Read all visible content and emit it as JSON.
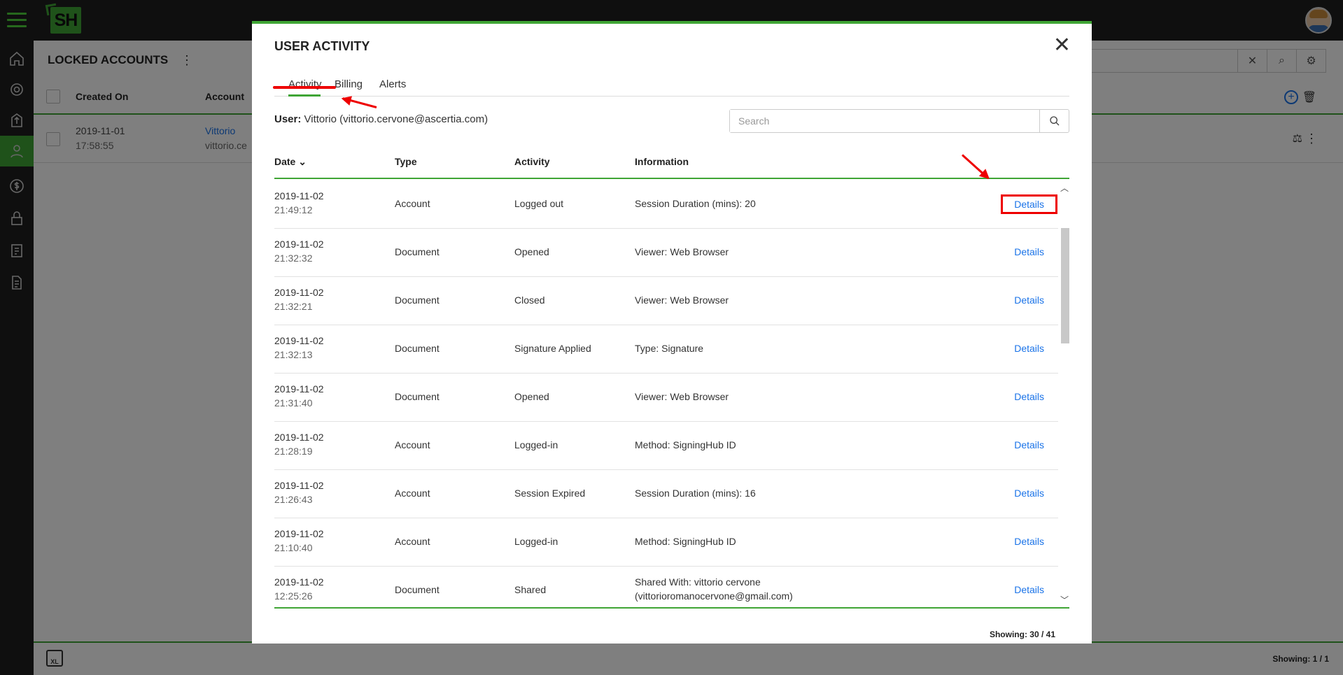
{
  "page": {
    "title": "LOCKED ACCOUNTS",
    "columns": [
      "Created On",
      "Account"
    ],
    "row": {
      "date": "2019-11-01",
      "time": "17:58:55",
      "name": "Vittorio",
      "email": "vittorio.ce"
    },
    "footer_showing": "Showing: 1 / 1",
    "footer_export": "XL"
  },
  "modal": {
    "title": "USER ACTIVITY",
    "tabs": [
      "Activity",
      "Billing",
      "Alerts"
    ],
    "active_tab": "Activity",
    "user_label": "User:",
    "user_value": "Vittorio (vittorio.cervone@ascertia.com)",
    "search_placeholder": "Search",
    "columns": {
      "date": "Date",
      "type": "Type",
      "activity": "Activity",
      "information": "Information"
    },
    "details_label": "Details",
    "rows": [
      {
        "date": "2019-11-02",
        "time": "21:49:12",
        "type": "Account",
        "activity": "Logged out",
        "info1": "Session Duration (mins): 20",
        "info2": ""
      },
      {
        "date": "2019-11-02",
        "time": "21:32:32",
        "type": "Document",
        "activity": "Opened",
        "info1": "Viewer: Web Browser",
        "info2": ""
      },
      {
        "date": "2019-11-02",
        "time": "21:32:21",
        "type": "Document",
        "activity": "Closed",
        "info1": "Viewer: Web Browser",
        "info2": ""
      },
      {
        "date": "2019-11-02",
        "time": "21:32:13",
        "type": "Document",
        "activity": "Signature Applied",
        "info1": "Type: Signature",
        "info2": ""
      },
      {
        "date": "2019-11-02",
        "time": "21:31:40",
        "type": "Document",
        "activity": "Opened",
        "info1": "Viewer: Web Browser",
        "info2": ""
      },
      {
        "date": "2019-11-02",
        "time": "21:28:19",
        "type": "Account",
        "activity": "Logged-in",
        "info1": "Method: SigningHub ID",
        "info2": ""
      },
      {
        "date": "2019-11-02",
        "time": "21:26:43",
        "type": "Account",
        "activity": "Session Expired",
        "info1": "Session Duration (mins): 16",
        "info2": ""
      },
      {
        "date": "2019-11-02",
        "time": "21:10:40",
        "type": "Account",
        "activity": "Logged-in",
        "info1": "Method: SigningHub ID",
        "info2": ""
      },
      {
        "date": "2019-11-02",
        "time": "12:25:26",
        "type": "Document",
        "activity": "Shared",
        "info1": "Shared With: vittorio cervone",
        "info2": "(vittorioromanocervone@gmail.com)"
      }
    ],
    "showing": "Showing: 30 / 41"
  },
  "app": {
    "logo": "SH",
    "accent_color": "#3fa535",
    "link_color": "#1a73e8",
    "annotation_color": "#e00000"
  },
  "icons": [
    "menu-icon",
    "home-icon",
    "gear-icon",
    "upload-icon",
    "user-icon",
    "dollar-icon",
    "lock-icon",
    "clipboard-icon",
    "document-icon",
    "search-icon",
    "close-icon",
    "add-icon",
    "trash-icon",
    "more-icon",
    "excel-icon"
  ]
}
